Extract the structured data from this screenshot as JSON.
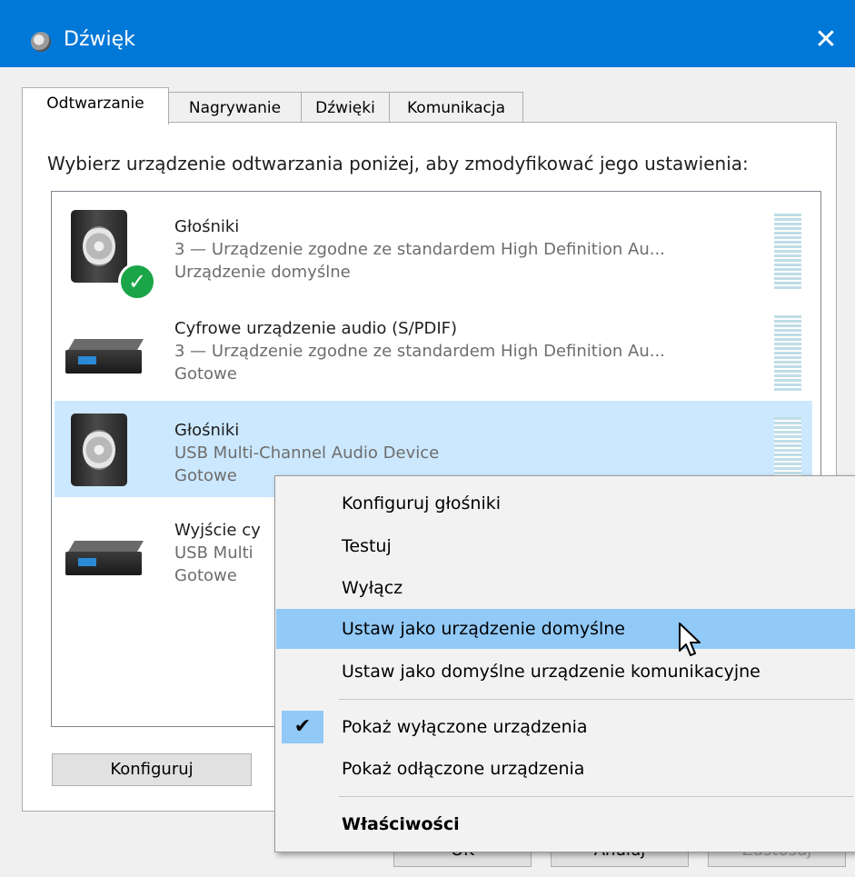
{
  "window": {
    "title": "Dźwięk",
    "close_glyph": "✕"
  },
  "tabs": [
    {
      "label": "Odtwarzanie",
      "active": true
    },
    {
      "label": "Nagrywanie",
      "active": false
    },
    {
      "label": "Dźwięki",
      "active": false
    },
    {
      "label": "Komunikacja",
      "active": false
    }
  ],
  "instruction": "Wybierz urządzenie odtwarzania poniżej, aby zmodyfikować jego ustawienia:",
  "devices": [
    {
      "name": "Głośniki",
      "description": "3 — Urządzenie zgodne ze standardem High Definition Au...",
      "status": "Urządzenie domyślne",
      "icon": "speaker-icon",
      "default": true,
      "selected": false
    },
    {
      "name": "Cyfrowe urządzenie audio (S/PDIF)",
      "description": "3 — Urządzenie zgodne ze standardem High Definition Au...",
      "status": "Gotowe",
      "icon": "digital-audio-box-icon",
      "default": false,
      "selected": false
    },
    {
      "name": "Głośniki",
      "description": "USB Multi-Channel Audio Device",
      "status": "Gotowe",
      "icon": "speaker-icon",
      "default": false,
      "selected": true
    },
    {
      "name": "Wyjście cy",
      "description": "USB Multi",
      "status": "Gotowe",
      "icon": "digital-audio-box-icon",
      "default": false,
      "selected": false
    }
  ],
  "buttons": {
    "configure": "Konfiguruj",
    "ok": "OK",
    "cancel": "Anuluj",
    "apply": "Zastosuj"
  },
  "context_menu": [
    {
      "label": "Konfiguruj głośniki"
    },
    {
      "label": "Testuj"
    },
    {
      "label": "Wyłącz"
    },
    {
      "label": "Ustaw jako urządzenie domyślne",
      "highlighted": true
    },
    {
      "label": "Ustaw jako domyślne urządzenie komunikacyjne"
    },
    {
      "label": "Pokaż wyłączone urządzenia",
      "checked": true
    },
    {
      "label": "Pokaż odłączone urządzenia"
    },
    {
      "label": "Właściwości",
      "bold": true
    }
  ],
  "colors": {
    "titlebar": "#0078d7",
    "selection": "#cce8ff",
    "menu_highlight": "#91c9f7",
    "default_badge": "#1aa548"
  }
}
